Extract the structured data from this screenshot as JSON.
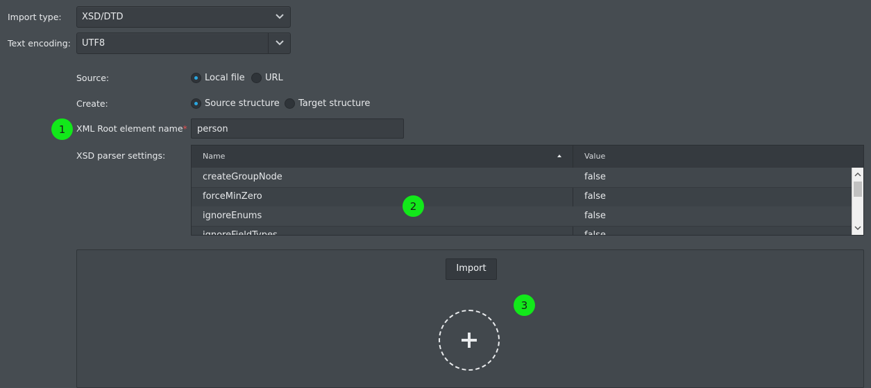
{
  "form": {
    "import_type_label": "Import type:",
    "import_type_value": "XSD/DTD",
    "encoding_label": "Text encoding:",
    "encoding_value": "UTF8",
    "source_label": "Source:",
    "source_options": [
      "Local file",
      "URL"
    ],
    "source_selected": "Local file",
    "create_label": "Create:",
    "create_options": [
      "Source structure",
      "Target structure"
    ],
    "create_selected": "Source structure",
    "root_label": "XML Root element name",
    "required_mark": "*",
    "root_value": "person",
    "xsd_settings_label": "XSD parser settings:"
  },
  "table": {
    "columns": [
      "Name",
      "Value"
    ],
    "sort_column": "Name",
    "rows": [
      {
        "name": "createGroupNode",
        "value": "false"
      },
      {
        "name": "forceMinZero",
        "value": "false"
      },
      {
        "name": "ignoreEnums",
        "value": "false"
      },
      {
        "name": "ignoreFieldTypes",
        "value": "false"
      }
    ]
  },
  "panel": {
    "import_button": "Import",
    "add_icon": "plus-icon"
  },
  "markers": [
    "1",
    "2",
    "3"
  ],
  "colors": {
    "background": "#464c51",
    "accent": "#2aa7e0",
    "marker": "#12e81a",
    "required": "#e05050"
  }
}
